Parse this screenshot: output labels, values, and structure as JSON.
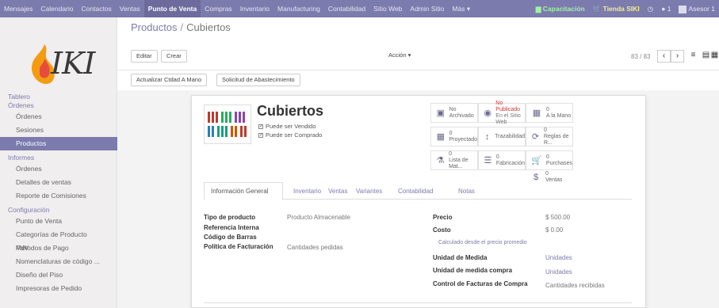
{
  "topbar": {
    "menu": [
      "Mensajes",
      "Calendario",
      "Contactos",
      "Ventas",
      "Punto de Venta",
      "Compras",
      "Inventario",
      "Manufacturing",
      "Contabilidad",
      "Sitio Web",
      "Admin Sitio",
      "Más ▾"
    ],
    "active_menu": "Punto de Venta",
    "capacitacion": "Capacitación",
    "tienda": "Tienda SIKI",
    "messages_count": "1",
    "user": "Asesor 1"
  },
  "logo": {
    "text": "IKI"
  },
  "sidebar": {
    "sections": [
      {
        "header": "Tablero",
        "items": []
      },
      {
        "header": "Órdenes",
        "items": [
          "Órdenes",
          "Sesiones",
          "Productos"
        ]
      },
      {
        "header": "Informes",
        "items": [
          "Órdenes",
          "Detalles de ventas",
          "Reporte de Comisiones"
        ]
      },
      {
        "header": "Configuración",
        "items": [
          "Punto de Venta",
          "Categorías de Producto PdV",
          "Métodos de Pago",
          "Nomenclaturas de código ...",
          "Diseño del Piso",
          "Impresoras de Pedido"
        ]
      }
    ],
    "active_item": "Productos"
  },
  "breadcrumb": {
    "parent": "Productos",
    "separator": "/",
    "current": "Cubiertos"
  },
  "buttons": {
    "edit": "Editar",
    "create": "Crear",
    "action": "Acción ▾",
    "update_qty": "Actualizar Ctdad A Mano",
    "procurement": "Solicitud de Abastecimiento"
  },
  "pager": {
    "text": "83 / 83"
  },
  "product": {
    "name": "Cubiertos",
    "can_be_sold": "Puede ser Vendido",
    "can_be_purchased": "Puede ser Comprado"
  },
  "smart_buttons": [
    {
      "name": "no-archivado",
      "line1": "",
      "line2": "No Archivado",
      "icon": "archive-icon"
    },
    {
      "name": "no-publicado",
      "line1": "No Publicado",
      "line2": "En el Sitio Web",
      "icon": "globe-icon",
      "red": true
    },
    {
      "name": "a-la-mano",
      "line1": "0",
      "line2": "A la Mano",
      "icon": "building-icon"
    },
    {
      "name": "proyectado",
      "line1": "0",
      "line2": "Proyectado",
      "icon": "building-icon"
    },
    {
      "name": "trazabilidad",
      "line1": "",
      "line2": "Trazabilidad",
      "icon": "arrows-icon"
    },
    {
      "name": "reglas",
      "line1": "0",
      "line2": "Reglas de R...",
      "icon": "refresh-icon"
    },
    {
      "name": "lista-mat",
      "line1": "0",
      "line2": "Lista de Mat...",
      "icon": "flask-icon"
    },
    {
      "name": "fabricacion",
      "line1": "0",
      "line2": "Fabricación",
      "icon": "list-icon"
    },
    {
      "name": "purchases",
      "line1": "0",
      "line2": "Purchases",
      "icon": "cart-icon"
    },
    {
      "name": "ventas",
      "line1": "0",
      "line2": "Ventas",
      "icon": "dollar-icon"
    }
  ],
  "tabs": [
    "Información General",
    "Inventario",
    "Ventas",
    "Variantes",
    "Contabilidad",
    "Notas"
  ],
  "general": {
    "tipo_label": "Tipo de producto",
    "tipo_value": "Producto Almacenable",
    "ref_label": "Referencia Interna",
    "barcode_label": "Código de Barras",
    "invoice_policy_label": "Política de Facturación",
    "invoice_policy_value": "Cantidades pedidas",
    "price_label": "Precio",
    "price_value": "$ 500.00",
    "cost_label": "Costo",
    "cost_value": "$ 0.00",
    "cost_link": "Calculado desde el precio promedio",
    "uom_label": "Unidad de Medida",
    "uom_value": "Unidades",
    "uom_po_label": "Unidad de medida compra",
    "uom_po_value": "Unidades",
    "bill_control_label": "Control de Facturas de Compra",
    "bill_control_value": "Cantidades recibidas"
  },
  "colors": {
    "brand": "#7c7bad",
    "logo_orange": "#f39c12"
  }
}
